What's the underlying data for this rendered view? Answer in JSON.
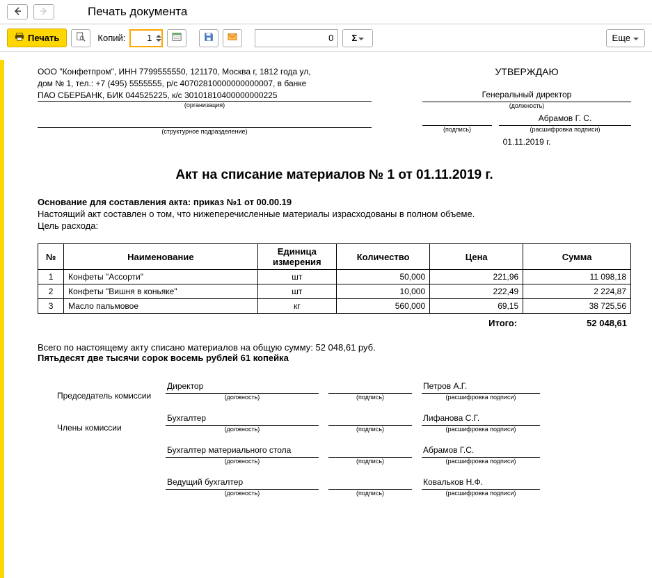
{
  "titlebar": {
    "title": "Печать документа"
  },
  "toolbar": {
    "print_label": "Печать",
    "copies_label": "Копий:",
    "copies_value": "1",
    "num_value": "0",
    "sigma_label": "Σ",
    "more_label": "Еще"
  },
  "header": {
    "org_line1": "ООО \"Конфетпром\", ИНН 7799555550, 121170, Москва г, 1812 года ул,",
    "org_line2": "дом № 1, тел.: +7 (495) 5555555, р/с 40702810000000000007, в банке",
    "org_line3": "ПАО СБЕРБАНК, БИК 044525225, к/с 30101810400000000225",
    "org_caption": "(организация)",
    "struct_caption": "(структурное подразделение)",
    "approve_title": "УТВЕРЖДАЮ",
    "position_value": "Генеральный директор",
    "position_caption": "(должность)",
    "sign_caption": "(подпись)",
    "decipher_value": "Абрамов Г. С.",
    "decipher_caption": "(расшифровка подписи)",
    "date_value": "01.11.2019 г."
  },
  "doc_title": "Акт на списание материалов № 1 от 01.11.2019 г.",
  "basis": {
    "label": "Основание для составления акта: ",
    "order": "приказ №1 от 00.00.19",
    "text": "Настоящий акт составлен о том, что нижеперечисленные материалы израсходованы в полном объеме.",
    "purpose": "Цель расхода:"
  },
  "table": {
    "headers": {
      "num": "№",
      "name": "Наименование",
      "unit": "Единица измерения",
      "qty": "Количество",
      "price": "Цена",
      "sum": "Сумма"
    },
    "rows": [
      {
        "num": "1",
        "name": "Конфеты \"Ассорти\"",
        "unit": "шт",
        "qty": "50,000",
        "price": "221,96",
        "sum": "11 098,18"
      },
      {
        "num": "2",
        "name": "Конфеты \"Вишня в коньяке\"",
        "unit": "шт",
        "qty": "10,000",
        "price": "222,49",
        "sum": "2 224,87"
      },
      {
        "num": "3",
        "name": "Масло пальмовое",
        "unit": "кг",
        "qty": "560,000",
        "price": "69,15",
        "sum": "38 725,56"
      }
    ],
    "total_label": "Итого:",
    "total_value": "52 048,61"
  },
  "summary": {
    "line1": "Всего по настоящему акту списано материалов на общую сумму: 52 048,61 руб.",
    "line2": "Пятьдесят две тысячи сорок восемь рублей 61 копейка"
  },
  "commission": {
    "chairman_label": "Председатель комиссии",
    "members_label": "Члены комиссии",
    "pos_caption": "(должность)",
    "sig_caption": "(подпись)",
    "name_caption": "(расшифровка подписи)",
    "rows": [
      {
        "position": "Директор",
        "name": "Петров А.Г."
      },
      {
        "position": "Бухгалтер",
        "name": "Лифанова С.Г."
      },
      {
        "position": "Бухгалтер материального стола",
        "name": "Абрамов Г.С."
      },
      {
        "position": "Ведущий бухгалтер",
        "name": "Ковальков Н.Ф."
      }
    ]
  }
}
